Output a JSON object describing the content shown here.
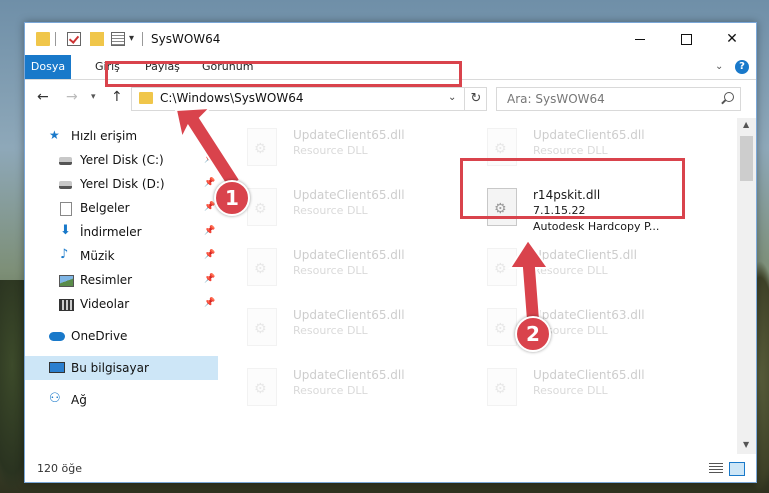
{
  "window": {
    "title": "SysWOW64"
  },
  "ribbon": {
    "tabs": [
      "Dosya",
      "Giriş",
      "Paylaş",
      "Görünüm"
    ]
  },
  "address": {
    "path": "C:\\Windows\\SysWOW64"
  },
  "search": {
    "placeholder": "Ara: SysWOW64"
  },
  "sidebar": {
    "items": [
      {
        "label": "Hızlı erişim",
        "icon": "star-icon"
      },
      {
        "label": "Yerel Disk (C:)",
        "icon": "drive-icon"
      },
      {
        "label": "Yerel Disk (D:)",
        "icon": "drive-icon"
      },
      {
        "label": "Belgeler",
        "icon": "documents-icon"
      },
      {
        "label": "İndirmeler",
        "icon": "download-icon"
      },
      {
        "label": "Müzik",
        "icon": "music-icon"
      },
      {
        "label": "Resimler",
        "icon": "pictures-icon"
      },
      {
        "label": "Videolar",
        "icon": "videos-icon"
      },
      {
        "label": "OneDrive",
        "icon": "cloud-icon"
      },
      {
        "label": "Bu bilgisayar",
        "icon": "computer-icon"
      },
      {
        "label": "Ağ",
        "icon": "network-icon"
      }
    ]
  },
  "files": {
    "items": [
      {
        "name": "UpdateClient65.dll",
        "meta": "Resource DLL"
      },
      {
        "name": "UpdateClient65.dll",
        "meta": "Resource DLL"
      },
      {
        "name": "UpdateClient65.dll",
        "meta": "Resource DLL"
      },
      {
        "name": "r14pskit.dll",
        "version": "7.1.15.22",
        "description": "Autodesk Hardcopy P..."
      },
      {
        "name": "UpdateClient65.dll",
        "meta": "Resource DLL"
      },
      {
        "name": "UpdateClient5.dll",
        "meta": "Resource DLL"
      },
      {
        "name": "UpdateClient65.dll",
        "meta": "Resource DLL"
      },
      {
        "name": "UpdateClient63.dll",
        "meta": "Resource DLL"
      },
      {
        "name": "UpdateClient65.dll",
        "meta": "Resource DLL"
      },
      {
        "name": "UpdateClient65.dll",
        "meta": "Resource DLL"
      }
    ]
  },
  "status": {
    "count": "120 öğe"
  },
  "annotations": {
    "badge1": "1",
    "badge2": "2",
    "highlight_color": "#d9434c"
  }
}
